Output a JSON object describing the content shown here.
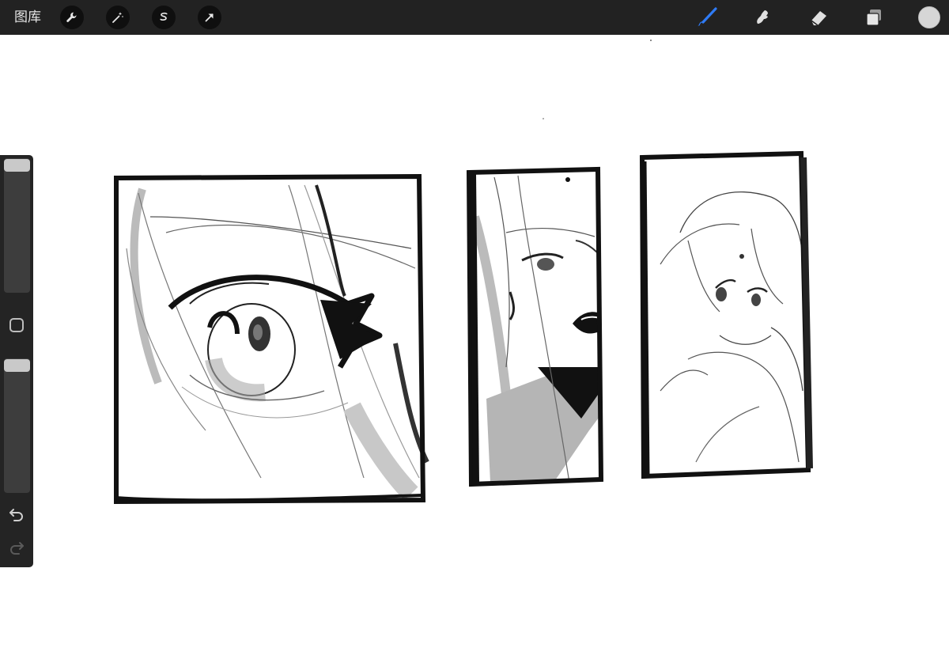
{
  "topbar": {
    "gallery_label": "图库",
    "left_tools": [
      "wrench-icon",
      "magic-wand-icon",
      "selection-icon",
      "transform-arrow-icon"
    ],
    "right_tools": [
      "brush-icon",
      "smudge-icon",
      "eraser-icon",
      "layers-icon"
    ],
    "active_tool": "brush-icon",
    "accent_color": "#2f7bf5",
    "current_color": "#d6d6d6"
  },
  "sidebar": {
    "brush_size_level": 0.0,
    "opacity_level": 0.0,
    "icons": [
      "modify-square-icon",
      "undo-icon",
      "redo-icon"
    ]
  },
  "canvas": {
    "background": "#ffffff",
    "panels": [
      "eye-close-up-panel",
      "smiling-face-panel",
      "hand-on-cheek-panel"
    ]
  }
}
